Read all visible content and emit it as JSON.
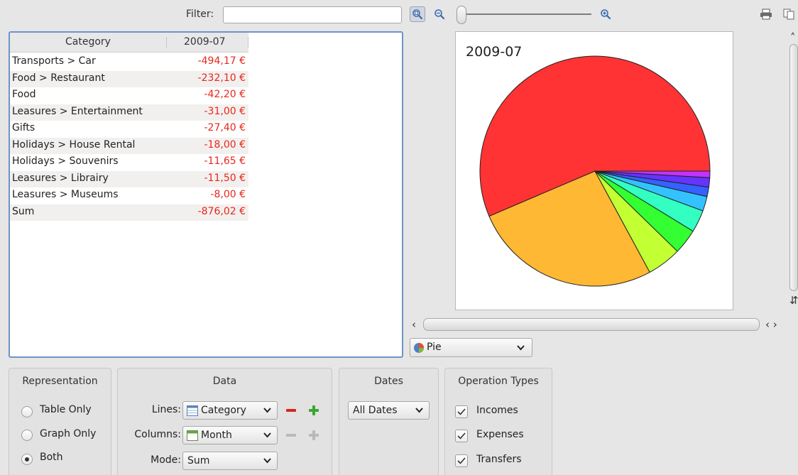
{
  "toolbar": {
    "filter_label": "Filter:",
    "filter_value": "",
    "zoom_level": 0
  },
  "table": {
    "headers": [
      "Category",
      "2009-07"
    ],
    "rows": [
      {
        "category": "Transports > Car",
        "value": "-494,17 €"
      },
      {
        "category": "Food > Restaurant",
        "value": "-232,10 €"
      },
      {
        "category": "Food",
        "value": "-42,20 €"
      },
      {
        "category": "Leasures > Entertainment",
        "value": "-31,00 €"
      },
      {
        "category": "Gifts",
        "value": "-27,40 €"
      },
      {
        "category": "Holidays > House Rental",
        "value": "-18,00 €"
      },
      {
        "category": "Holidays > Souvenirs",
        "value": "-11,65 €"
      },
      {
        "category": "Leasures > Librairy",
        "value": "-11,50 €"
      },
      {
        "category": "Leasures > Museums",
        "value": "-8,00 €"
      },
      {
        "category": "Sum",
        "value": "-876,02 €"
      }
    ]
  },
  "chart_data": {
    "type": "pie",
    "title": "2009-07",
    "categories": [
      "Transports > Car",
      "Food > Restaurant",
      "Food",
      "Leasures > Entertainment",
      "Gifts",
      "Holidays > House Rental",
      "Holidays > Souvenirs",
      "Leasures > Librairy",
      "Leasures > Museums"
    ],
    "values": [
      494.17,
      232.1,
      42.2,
      31.0,
      27.4,
      18.0,
      11.65,
      11.5,
      8.0
    ],
    "colors": [
      "#ff3333",
      "#ffb833",
      "#c2ff33",
      "#33ff33",
      "#33ffc2",
      "#33c2ff",
      "#3362ff",
      "#6633ff",
      "#c233ff"
    ]
  },
  "graph": {
    "type_label": "Pie"
  },
  "representation": {
    "title": "Representation",
    "options": [
      "Table Only",
      "Graph Only",
      "Both"
    ],
    "selected": "Both"
  },
  "data_group": {
    "title": "Data",
    "lines_label": "Lines:",
    "lines_value": "Category",
    "columns_label": "Columns:",
    "columns_value": "Month",
    "mode_label": "Mode:",
    "mode_value": "Sum"
  },
  "dates_group": {
    "title": "Dates",
    "value": "All Dates"
  },
  "operation_types": {
    "title": "Operation Types",
    "items": [
      {
        "label": "Incomes",
        "checked": true
      },
      {
        "label": "Expenses",
        "checked": true
      },
      {
        "label": "Transfers",
        "checked": true
      }
    ]
  },
  "colors": {
    "negative_value": "#e8271c",
    "focus_border": "#6d94c7"
  }
}
